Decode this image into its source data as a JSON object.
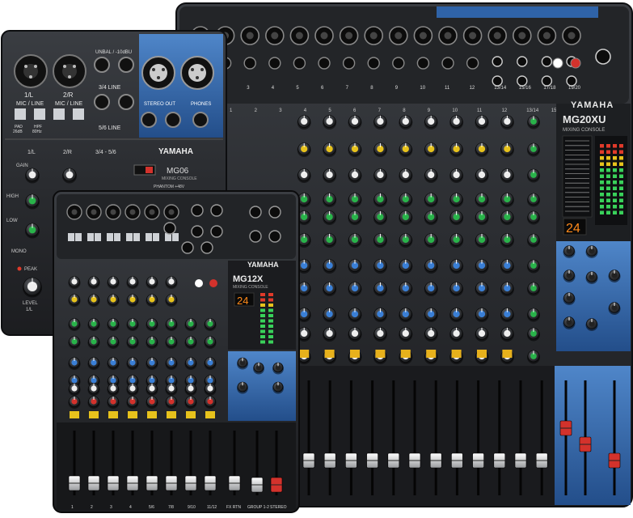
{
  "colors": {
    "chassis": "#2a2c30",
    "chassis_dark": "#141517",
    "panel_blue": "#2f63a8",
    "panel_blue_light": "#4f86c9",
    "knob_green": "#29b34a",
    "knob_blue": "#3a7fd6",
    "knob_red": "#d3322c",
    "knob_yellow": "#e7c21c",
    "knob_white": "#eeeeee",
    "led_green": "#39d15a",
    "led_red": "#e03a2a",
    "display_orange": "#ff8a1a"
  },
  "mg20xu": {
    "brand": "YAMAHA",
    "model": "MG20XU",
    "subtitle": "MIXING CONSOLE",
    "channel_labels": [
      "1",
      "2",
      "3",
      "4",
      "5",
      "6",
      "7",
      "8",
      "9",
      "10",
      "11",
      "12",
      "13/14",
      "15/16",
      "17/18",
      "19/20"
    ],
    "display_value": "24"
  },
  "mg06": {
    "brand": "YAMAHA",
    "model": "MG06",
    "subtitle": "MIXING CONSOLE",
    "input_labels": [
      "1/L",
      "2/R",
      "3/4 LINE",
      "5/6 LINE"
    ],
    "mic_line_label": "MIC / LINE",
    "unbal_label": "UNBAL / -10dBU",
    "stereo_out_label": "STEREO OUT",
    "phones_label": "PHONES",
    "pad_label": "PAD",
    "hpf_label": "HPF",
    "pad_value": "26dB",
    "hpf_value": "80Hz",
    "bottom_labels": [
      "1/L",
      "2/R",
      "3/4 - 5/6"
    ],
    "gain_label": "GAIN",
    "high_label": "HIGH",
    "low_label": "LOW",
    "phantom_label": "PHANTOM +48V",
    "mono_label": "MONO",
    "peak_label": "PEAK",
    "level_label": "LEVEL",
    "level_channel": "1/L"
  },
  "mg12x": {
    "brand": "YAMAHA",
    "model": "MG12X",
    "subtitle": "MIXING CONSOLE",
    "display_value": "24",
    "channel_labels": [
      "1",
      "2",
      "3",
      "4",
      "5/6",
      "7/8",
      "9/10",
      "11/12"
    ],
    "fx_rtn_label": "FX RTN",
    "group_label": "GROUP 1-2",
    "stereo_label": "STEREO"
  }
}
